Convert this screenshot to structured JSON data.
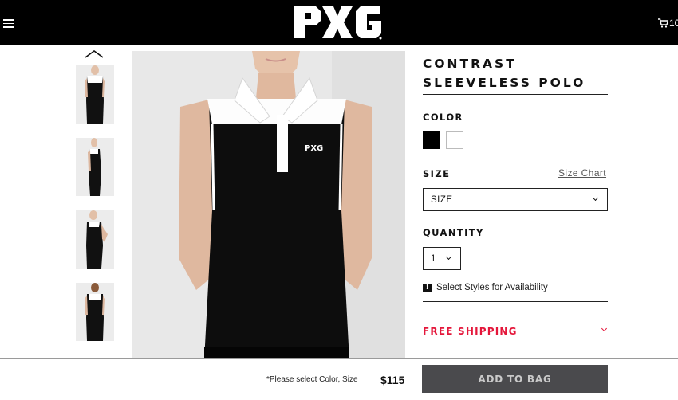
{
  "header": {
    "brand": "PXG",
    "cart_count": "10"
  },
  "product": {
    "title_line1": "CONTRAST",
    "title_line2": "SLEEVELESS POLO",
    "color_label": "COLOR",
    "colors": [
      {
        "name": "black",
        "hex": "#000000",
        "selected": true
      },
      {
        "name": "white",
        "hex": "#ffffff",
        "selected": false
      }
    ],
    "size_label": "SIZE",
    "size_chart_link": "Size Chart",
    "size_select_value": "SIZE",
    "quantity_label": "QUANTITY",
    "quantity_value": "1",
    "availability_text": "Select Styles for Availability",
    "free_shipping": "FREE SHIPPING"
  },
  "thumbnails": [
    {
      "name": "front"
    },
    {
      "name": "side"
    },
    {
      "name": "three-quarter"
    },
    {
      "name": "back"
    }
  ],
  "bottom_bar": {
    "notice": "*Please select Color, Size",
    "price": "$115",
    "add_to_bag": "ADD TO BAG"
  },
  "colors": {
    "header_bg": "#000000",
    "accent_red": "#e4163a",
    "button_bg": "#4a4a4d",
    "button_text": "#c9c9c9"
  }
}
